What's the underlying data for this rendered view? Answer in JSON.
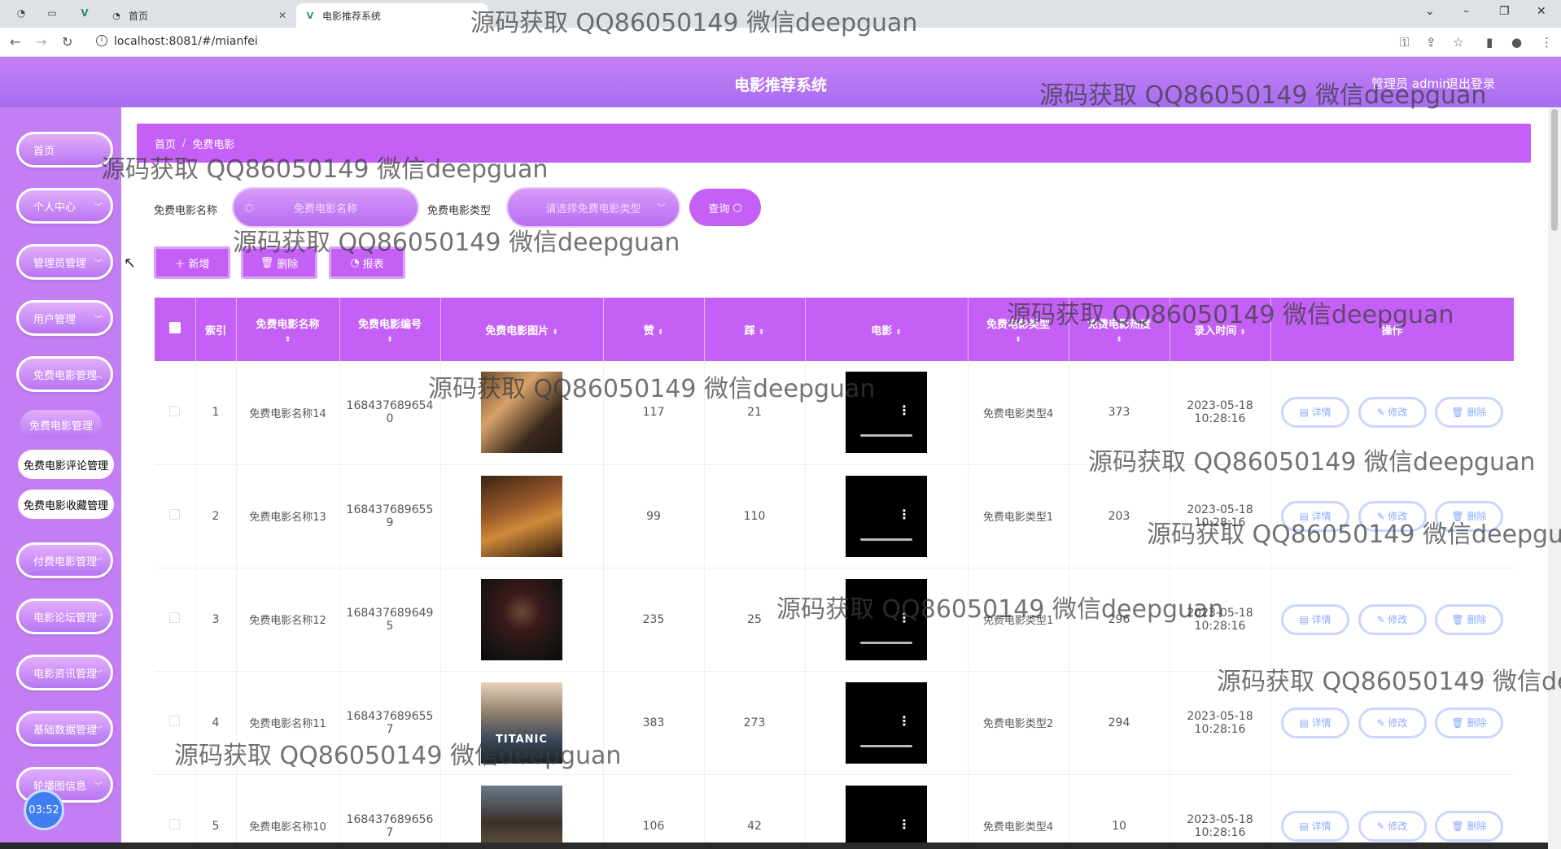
{
  "browser": {
    "tabs": [
      {
        "label": "首页"
      },
      {
        "label": "电影推荐系统"
      }
    ],
    "url": "localhost:8081/#/mianfei"
  },
  "header": {
    "title": "电影推荐系统",
    "admin": "管理员 admin",
    "logout": "退出登录"
  },
  "sidebar": {
    "items": [
      {
        "label": "首页"
      },
      {
        "label": "个人中心"
      },
      {
        "label": "管理员管理"
      },
      {
        "label": "用户管理"
      },
      {
        "label": "免费电影管理"
      },
      {
        "label": "付费电影管理"
      },
      {
        "label": "电影论坛管理"
      },
      {
        "label": "电影资讯管理"
      },
      {
        "label": "基础数据管理"
      },
      {
        "label": "轮播图信息"
      }
    ],
    "subitems": [
      {
        "label": "免费电影管理"
      },
      {
        "label": "免费电影评论管理"
      },
      {
        "label": "免费电影收藏管理"
      }
    ],
    "timer": "03:52"
  },
  "breadcrumb": {
    "home": "首页",
    "sep": "/",
    "current": "免费电影"
  },
  "search": {
    "name_label": "免费电影名称",
    "name_placeholder": "免费电影名称",
    "type_label": "免费电影类型",
    "type_placeholder": "请选择免费电影类型",
    "button": "查询"
  },
  "actions": {
    "add": "新增",
    "delete": "删除",
    "report": "报表"
  },
  "table": {
    "headers": {
      "index": "索引",
      "name": "免费电影名称",
      "code": "免费电影编号",
      "image": "免费电影图片",
      "like": "赞",
      "dislike": "踩",
      "video": "电影",
      "type": "免费电影类型",
      "clicks": "免费电影热度",
      "time": "录入时间",
      "ops": "操作"
    },
    "rows": [
      {
        "index": "1",
        "name": "免费电影名称14",
        "code": "1684376896540",
        "like": "117",
        "dislike": "21",
        "type": "免费电影类型4",
        "clicks": "373",
        "time": "2023-05-18 10:28:16"
      },
      {
        "index": "2",
        "name": "免费电影名称13",
        "code": "1684376896559",
        "like": "99",
        "dislike": "110",
        "type": "免费电影类型1",
        "clicks": "203",
        "time": "2023-05-18 10:28:16"
      },
      {
        "index": "3",
        "name": "免费电影名称12",
        "code": "1684376896495",
        "like": "235",
        "dislike": "25",
        "type": "免费电影类型1",
        "clicks": "296",
        "time": "2023-05-18 10:28:16"
      },
      {
        "index": "4",
        "name": "免费电影名称11",
        "code": "1684376896557",
        "like": "383",
        "dislike": "273",
        "type": "免费电影类型2",
        "clicks": "294",
        "time": "2023-05-18 10:28:16",
        "poster_text": "TITANIC"
      },
      {
        "index": "5",
        "name": "免费电影名称10",
        "code": "1684376896567",
        "like": "106",
        "dislike": "42",
        "type": "免费电影类型4",
        "clicks": "10",
        "time": "2023-05-18 10:28:16"
      }
    ],
    "op_labels": {
      "detail": "详情",
      "edit": "修改",
      "delete": "删除"
    }
  },
  "watermark": "源码获取 QQ86050149 微信deepguan",
  "colors": {
    "primary": "#c460f5",
    "sidebar": "#c47ef3",
    "op_button": "#8fa9ff"
  }
}
